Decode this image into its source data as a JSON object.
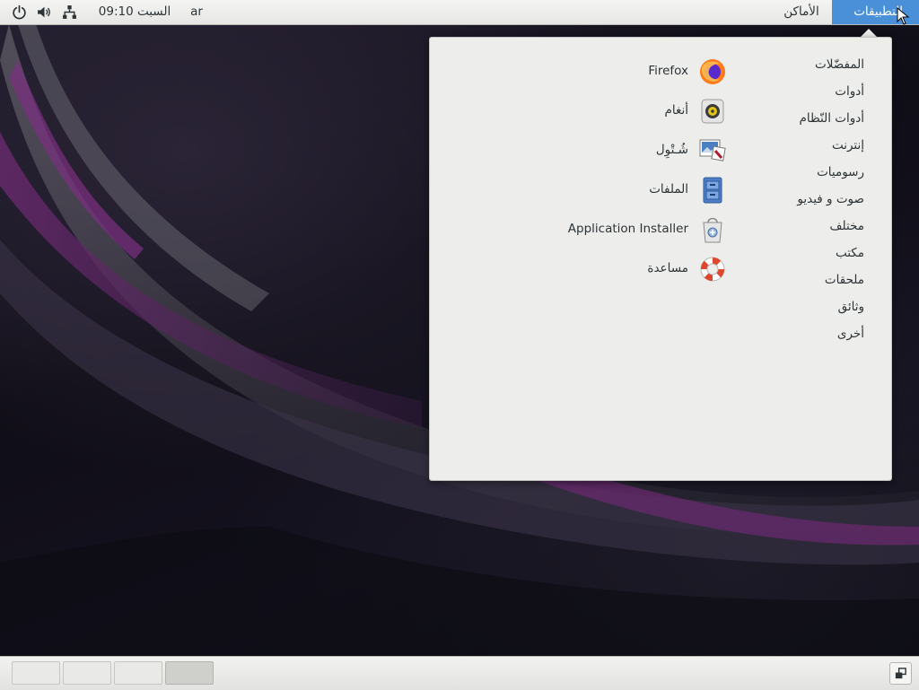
{
  "topbar": {
    "applications_label": "التطبيقات",
    "places_label": "الأماكن",
    "language": "ar",
    "clock": "السبت 09:10",
    "icons": [
      "power-icon",
      "volume-icon",
      "network-icon"
    ]
  },
  "menu": {
    "categories": [
      "المفضّلات",
      "أدوات",
      "أدوات النّظام",
      "إنترنت",
      "رسوميات",
      "صوت و فيديو",
      "مختلف",
      "مكتب",
      "ملحقات",
      "وثائق",
      "أخرى"
    ],
    "apps": [
      {
        "label": "Firefox",
        "icon": "firefox-icon"
      },
      {
        "label": "أنغام",
        "icon": "music-player-icon"
      },
      {
        "label": "شُـتْوِل",
        "icon": "screenshot-icon"
      },
      {
        "label": "الملفات",
        "icon": "file-manager-icon"
      },
      {
        "label": "Application Installer",
        "icon": "software-installer-icon"
      },
      {
        "label": "مساعدة",
        "icon": "help-lifebuoy-icon"
      }
    ]
  },
  "bottombar": {
    "workspaces": 4,
    "active_workspace": 4
  },
  "colors": {
    "accent": "#4a90d9",
    "panel": "#ededec"
  }
}
